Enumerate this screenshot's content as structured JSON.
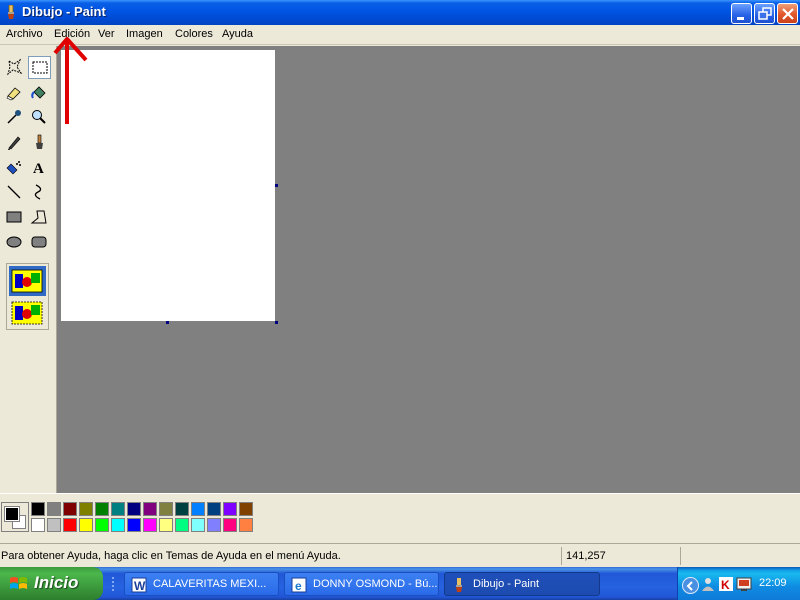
{
  "window": {
    "title": "Dibujo - Paint"
  },
  "menu": {
    "items": [
      "Archivo",
      "Edición",
      "Ver",
      "Imagen",
      "Colores",
      "Ayuda"
    ]
  },
  "toolbox": {
    "tools": [
      "free-select",
      "rect-select",
      "eraser",
      "fill",
      "color-picker",
      "magnifier",
      "pencil",
      "brush",
      "airbrush",
      "text",
      "line",
      "curve",
      "rectangle",
      "polygon",
      "ellipse",
      "rounded-rectangle"
    ],
    "selected_tool": "rect-select"
  },
  "palette": {
    "foreground": "#000000",
    "background": "#ffffff",
    "colors_top": [
      "#000000",
      "#808080",
      "#800000",
      "#808000",
      "#008000",
      "#008080",
      "#000080",
      "#800080",
      "#808040",
      "#004040",
      "#0080ff",
      "#004080",
      "#8000ff",
      "#804000"
    ],
    "colors_bottom": [
      "#ffffff",
      "#c0c0c0",
      "#ff0000",
      "#ffff00",
      "#00ff00",
      "#00ffff",
      "#0000ff",
      "#ff00ff",
      "#ffff80",
      "#00ff80",
      "#80ffff",
      "#8080ff",
      "#ff0080",
      "#ff8040"
    ]
  },
  "status": {
    "help_text": "Para obtener Ayuda, haga clic en Temas de Ayuda en el menú Ayuda.",
    "coords": "141,257"
  },
  "taskbar": {
    "start_label": "Inicio",
    "tasks": [
      {
        "label": "CALAVERITAS MEXI...",
        "icon": "word-icon"
      },
      {
        "label": "DONNY OSMOND - Bú...",
        "icon": "ie-icon"
      },
      {
        "label": "Dibujo - Paint",
        "icon": "paint-icon",
        "active": true
      }
    ],
    "clock": "22:09"
  },
  "colors": {
    "title_bar": "#0054e3",
    "workspace": "#808080",
    "annotation": "#e00000"
  }
}
